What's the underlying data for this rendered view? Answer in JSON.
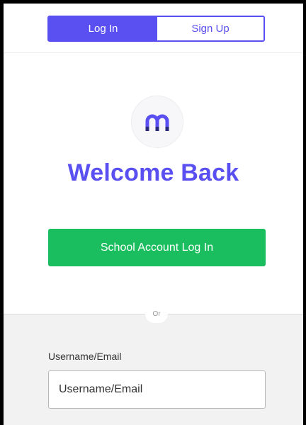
{
  "tabs": {
    "login_label": "Log In",
    "signup_label": "Sign Up"
  },
  "logo": {
    "icon": "m-logo-icon"
  },
  "main": {
    "title": "Welcome Back",
    "school_button_label": "School Account Log In",
    "divider_label": "Or"
  },
  "form": {
    "username_label": "Username/Email",
    "username_placeholder": "Username/Email",
    "username_value": ""
  },
  "colors": {
    "brand": "#5a4ff0",
    "school_button": "#1abe5e",
    "lower_background": "#f2f2f2"
  }
}
